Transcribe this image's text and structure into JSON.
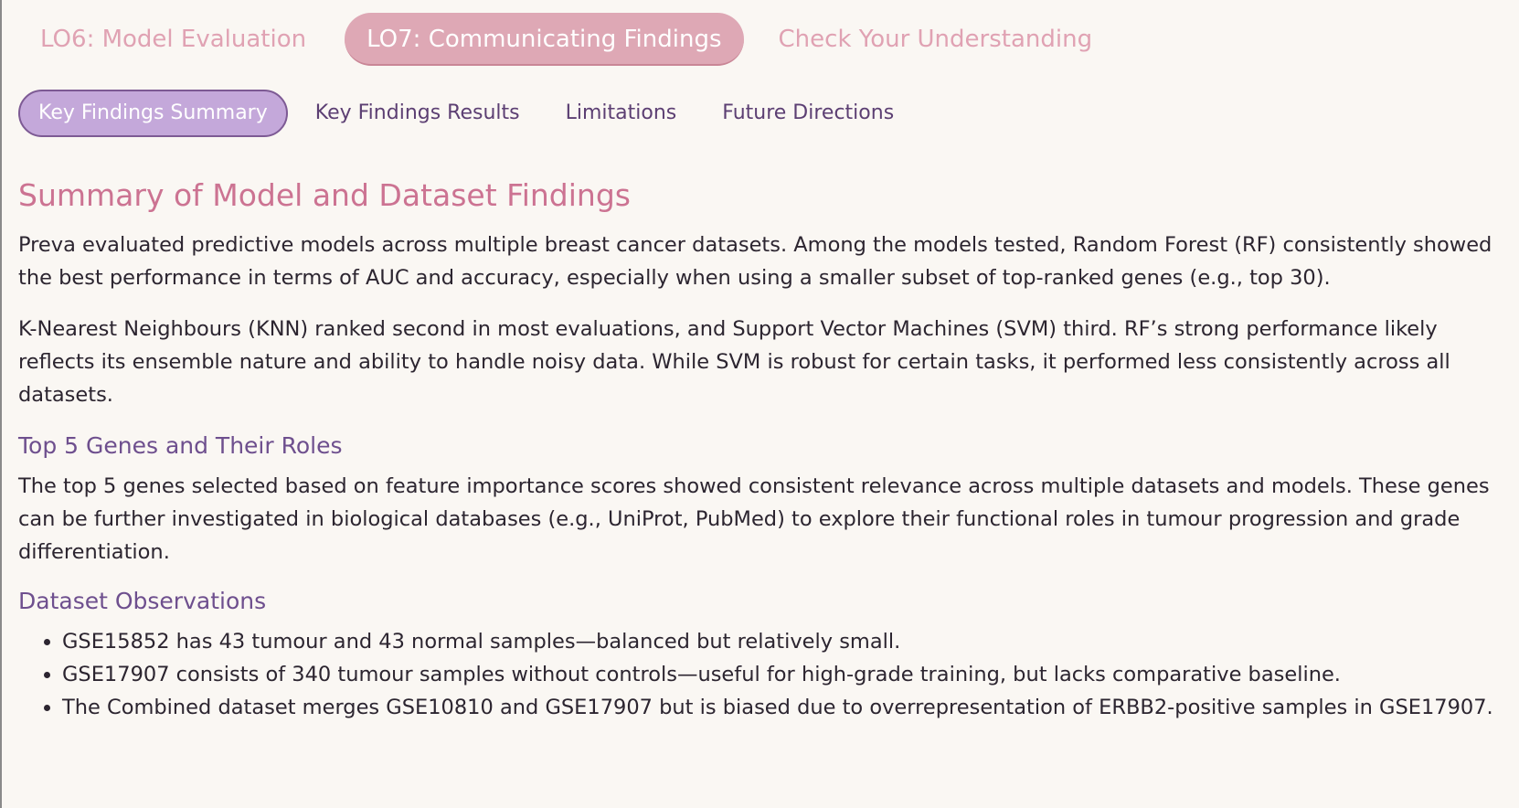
{
  "tabs_primary": [
    {
      "label": "LO6: Model Evaluation"
    },
    {
      "label": "LO7: Communicating Findings"
    },
    {
      "label": "Check Your Understanding"
    }
  ],
  "tabs_secondary": [
    {
      "label": "Key Findings Summary"
    },
    {
      "label": "Key Findings Results"
    },
    {
      "label": "Limitations"
    },
    {
      "label": "Future Directions"
    }
  ],
  "content": {
    "heading": "Summary of Model and Dataset Findings",
    "paragraph1": "Preva evaluated predictive models across multiple breast cancer datasets. Among the models tested, Random Forest (RF) consistently showed the best performance in terms of AUC and accuracy, especially when using a smaller subset of top-ranked genes (e.g., top 30).",
    "paragraph2": "K-Nearest Neighbours (KNN) ranked second in most evaluations, and Support Vector Machines (SVM) third. RF’s strong performance likely reflects its ensemble nature and ability to handle noisy data. While SVM is robust for certain tasks, it performed less consistently across all datasets.",
    "genes_heading": "Top 5 Genes and Their Roles",
    "genes_paragraph": "The top 5 genes selected based on feature importance scores showed consistent relevance across multiple datasets and models. These genes can be further investigated in biological databases (e.g., UniProt, PubMed) to explore their functional roles in tumour progression and grade differentiation.",
    "dataset_heading": "Dataset Observations",
    "observations": [
      "GSE15852 has 43 tumour and 43 normal samples—balanced but relatively small.",
      "GSE17907 consists of 340 tumour samples without controls—useful for high-grade training, but lacks comparative baseline.",
      "The Combined dataset merges GSE10810 and GSE17907 but is biased due to overrepresentation of ERBB2-positive samples in GSE17907."
    ]
  },
  "colors": {
    "background": "#faf7f3",
    "primary_tab_text": "#e0a2b3",
    "primary_tab_active_bg": "#dea8b5",
    "secondary_tab_text": "#5c3f73",
    "secondary_tab_active_bg": "#c4a8da",
    "heading": "#cc7392",
    "subheading": "#6e4f8e"
  }
}
